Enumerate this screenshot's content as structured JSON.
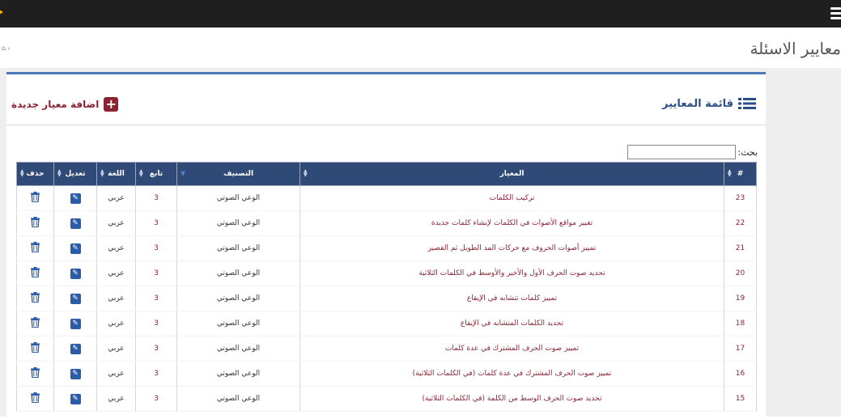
{
  "page_title": "معايير الاسئلة",
  "breadcrumb_icon": "home-icon",
  "list_title": "قائمة المعايير",
  "add_button": "اضافة معيار جديدة",
  "search": {
    "label": "بحث:",
    "value": ""
  },
  "columns": [
    "#",
    "المعيار",
    "التصنيف",
    "تابع",
    "اللغة",
    "تعديل",
    "حذف"
  ],
  "colors": {
    "header_bg": "#2f4a77",
    "accent_red": "#8b2332",
    "panel_border": "#4a78b8",
    "edit_blue": "#2a5ca8"
  },
  "rows": [
    {
      "id": "23",
      "criterion": "تركيب الكلمات",
      "category": "الوعي الصوتي",
      "follow": "3",
      "language": "عربي"
    },
    {
      "id": "22",
      "criterion": "تغيير مواقع الأصوات في الكلمات لإنشاء كلمات جديدة",
      "category": "الوعي الصوتي",
      "follow": "3",
      "language": "عربي"
    },
    {
      "id": "21",
      "criterion": "تمييز أصوات الحروف مع حركات المد الطويل ثم القصير",
      "category": "الوعي الصوتي",
      "follow": "3",
      "language": "عربي"
    },
    {
      "id": "20",
      "criterion": "تحديد صوت الحرف الأول والأخير والأوسط في الكلمات الثلاثية",
      "category": "الوعي الصوتي",
      "follow": "3",
      "language": "عربي"
    },
    {
      "id": "19",
      "criterion": "تمييز كلمات تتشابه في الإيقاع",
      "category": "الوعي الصوتي",
      "follow": "3",
      "language": "عربي"
    },
    {
      "id": "18",
      "criterion": "تحديد الكلمات المتشابه في الإيقاع",
      "category": "الوعي الصوتي",
      "follow": "3",
      "language": "عربي"
    },
    {
      "id": "17",
      "criterion": "تمييز صوت الحرف المشترك في عدة كلمات",
      "category": "الوعي الصوتي",
      "follow": "3",
      "language": "عربي"
    },
    {
      "id": "16",
      "criterion": "تمييز صوت الحرف المشترك في عدة كلمات (في الكلمات الثلاثية)",
      "category": "الوعي الصوتي",
      "follow": "3",
      "language": "عربي"
    },
    {
      "id": "15",
      "criterion": "تحديد صوت الحرف الوسط من الكلمة (في الكلمات الثلاثية)",
      "category": "الوعي الصوتي",
      "follow": "3",
      "language": "عربي"
    }
  ]
}
